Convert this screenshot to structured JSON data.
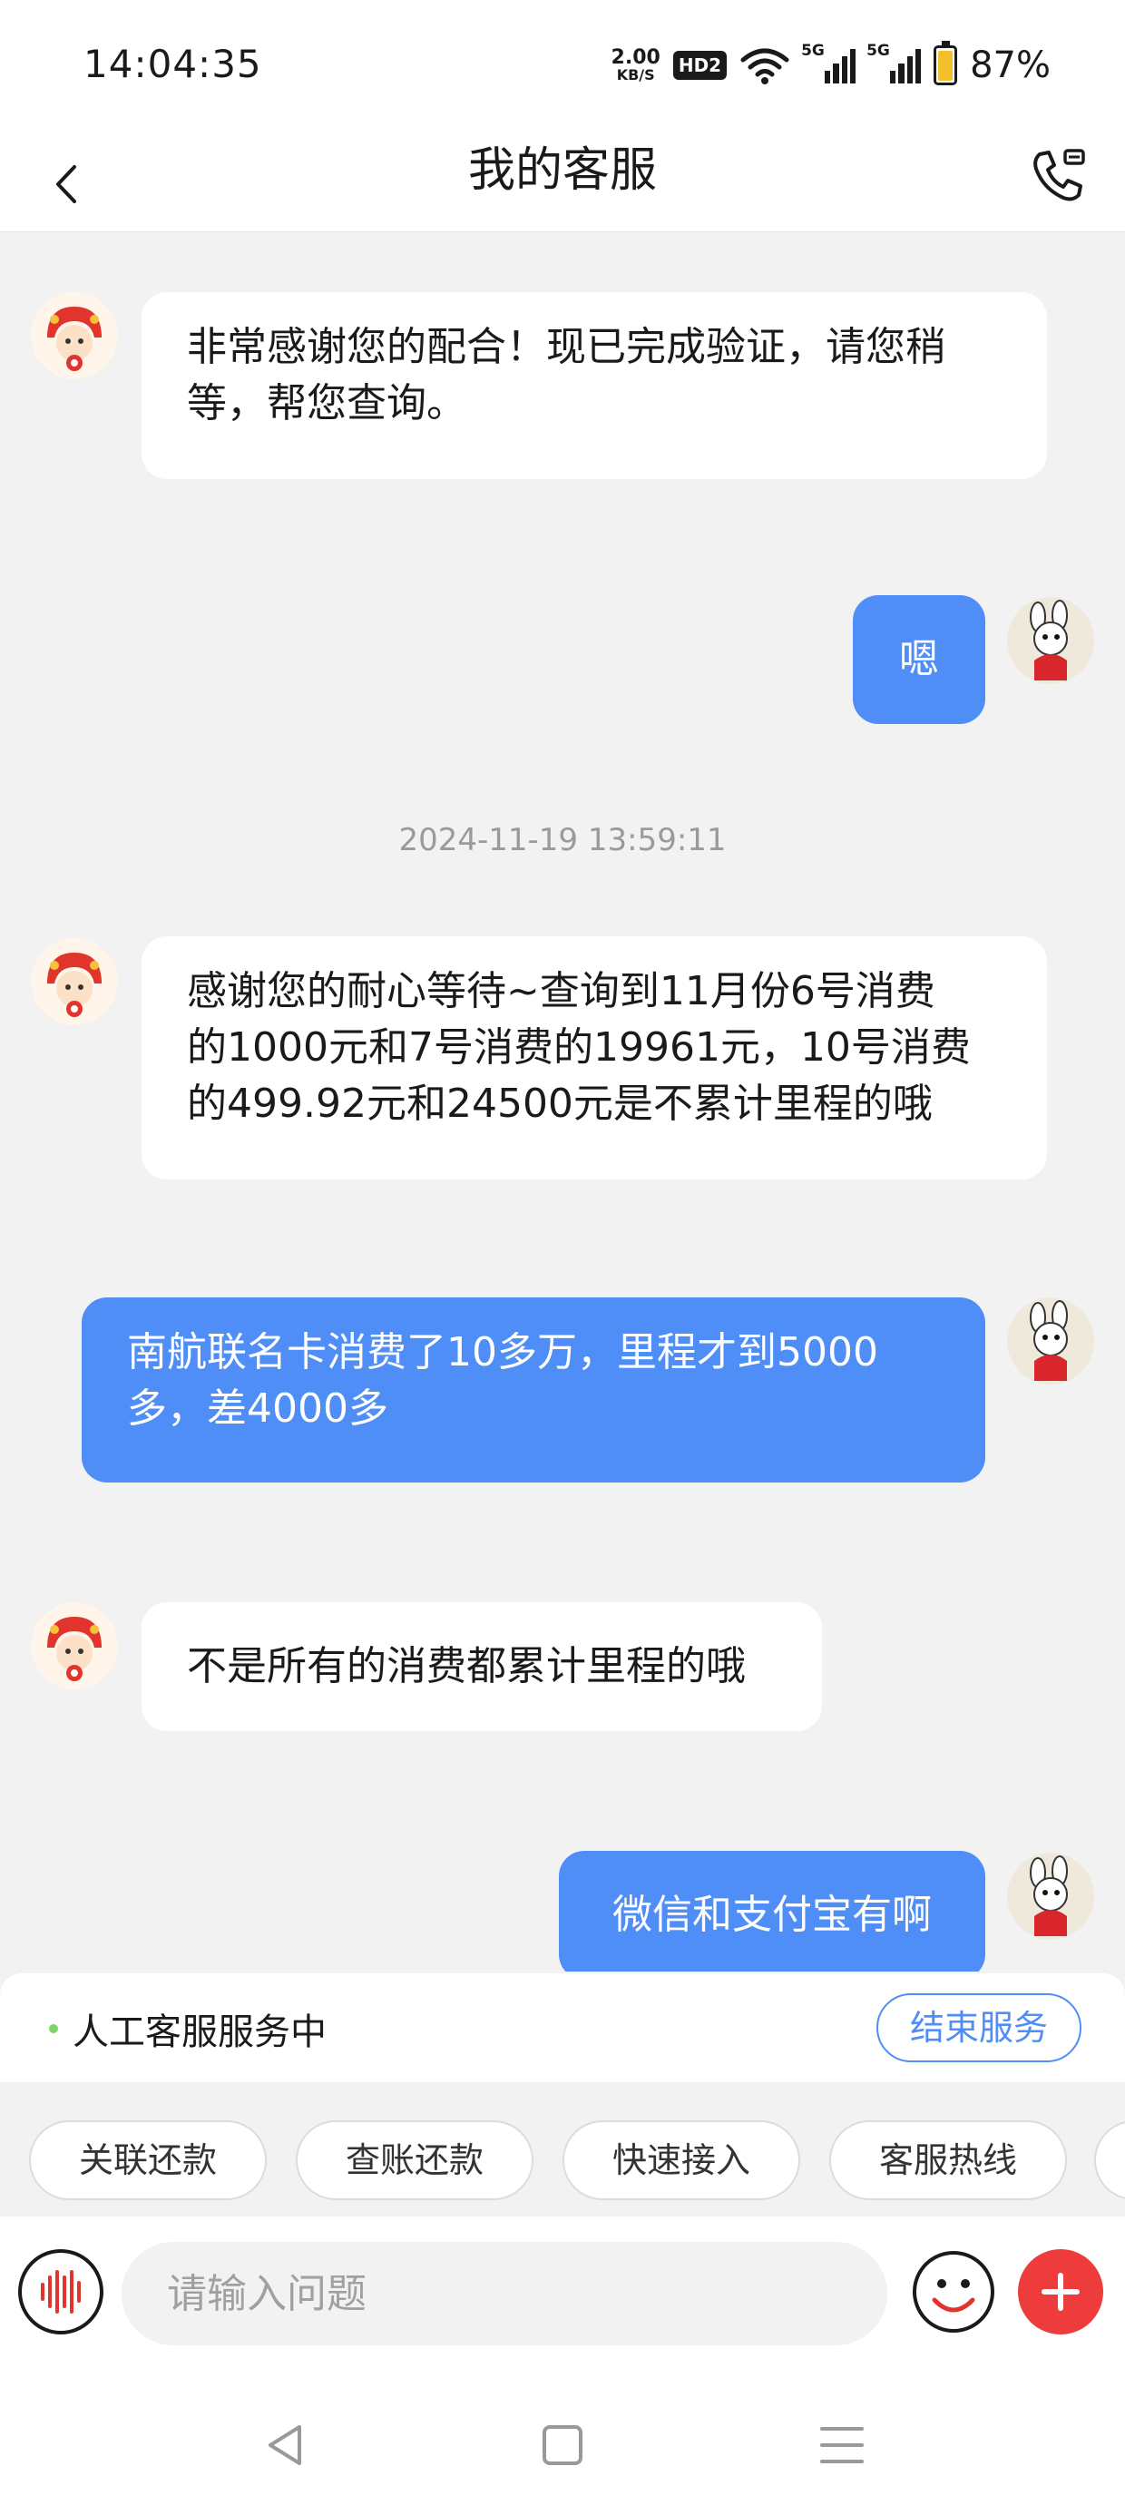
{
  "status_bar": {
    "time": "14:04:35",
    "net_speed_value": "2.00",
    "net_speed_unit": "KB/S",
    "hd_badge": "HD2",
    "signal_1_label": "5G",
    "signal_2_label": "5G",
    "battery_percent": "87%",
    "battery_level": 0.87,
    "icons": [
      "wifi-icon",
      "signal-icon",
      "signal-icon",
      "battery-icon"
    ]
  },
  "header": {
    "title": "我的客服",
    "back_icon": "chevron-left-icon",
    "phone_icon": "phone-settings-icon"
  },
  "chat": {
    "timestamp": "2024-11-19 13:59:11",
    "messages": [
      {
        "side": "in",
        "lines": [
          "非常感谢您的配合！现已完成验证，请您稍",
          "等，帮您查询。"
        ]
      },
      {
        "side": "out",
        "lines": [
          "嗯"
        ]
      },
      {
        "side": "in",
        "lines": [
          "感谢您的耐心等待~查询到11月份6号消费",
          "的1000元和7号消费的19961元，10号消费",
          "的499.92元和24500元是不累计里程的哦"
        ]
      },
      {
        "side": "out",
        "lines": [
          "南航联名卡消费了10多万，里程才到5000",
          "多，差4000多"
        ]
      },
      {
        "side": "in",
        "lines": [
          "不是所有的消费都累计里程的哦"
        ]
      },
      {
        "side": "out",
        "lines": [
          "微信和支付宝有啊"
        ]
      }
    ]
  },
  "service": {
    "status": "人工客服服务中",
    "end_button": "结束服务",
    "status_color": "#7cd46a"
  },
  "quick_actions": [
    "关联还款",
    "查账还款",
    "快速接入",
    "客服热线"
  ],
  "input": {
    "placeholder": "请输入问题",
    "value": ""
  },
  "colors": {
    "accent": "#4f8ef7",
    "plus_button": "#ee3b3b",
    "background": "#f2f2f2"
  }
}
